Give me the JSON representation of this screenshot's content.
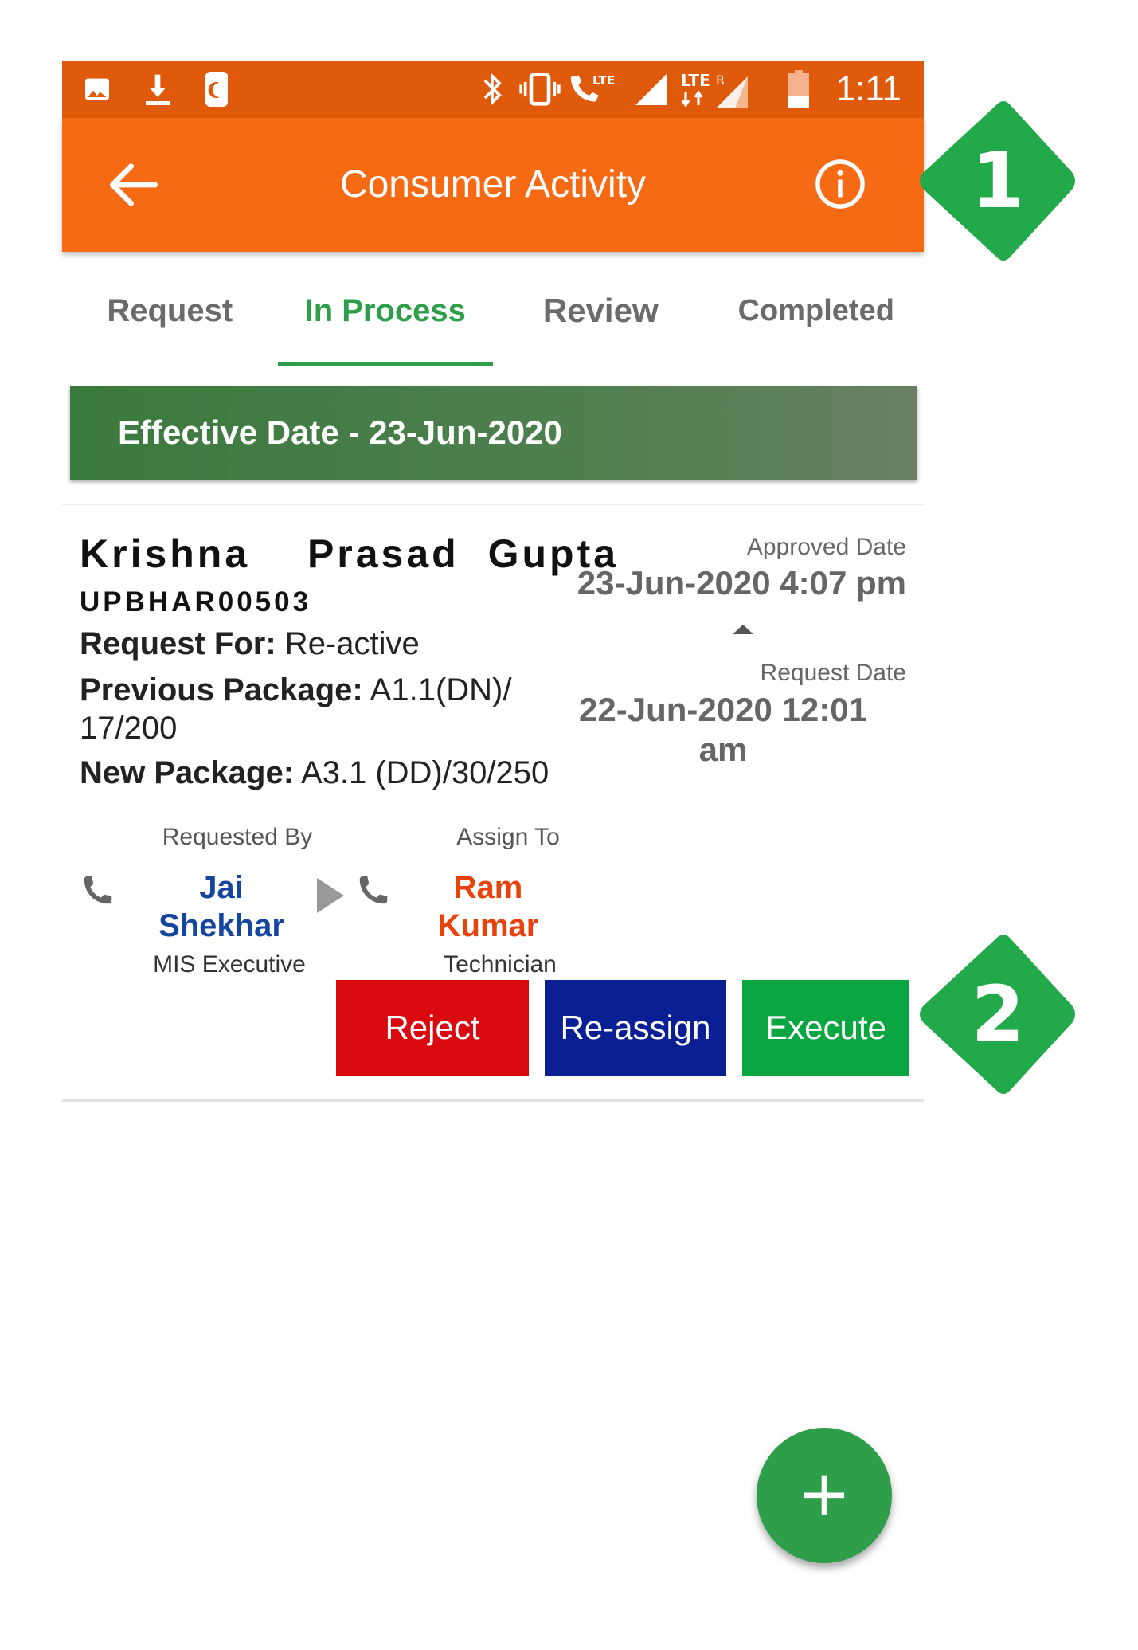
{
  "status_bar": {
    "time": "1:11",
    "left_icons": [
      "image-icon",
      "download-icon",
      "moon-notification-icon"
    ],
    "right_icons": [
      "bluetooth-icon",
      "vibrate-icon",
      "volte-call-icon",
      "signal-icon",
      "lte-roaming-signal-icon",
      "battery-low-icon"
    ],
    "lte_label": "LTE",
    "roaming_label": "R"
  },
  "app_bar": {
    "title": "Consumer Activity",
    "back_icon": "arrow-left-icon",
    "info_icon": "info-icon"
  },
  "tabs": [
    {
      "label": "Request",
      "active": false
    },
    {
      "label": "In Process",
      "active": true
    },
    {
      "label": "Review",
      "active": false
    },
    {
      "label": "Completed",
      "active": false
    }
  ],
  "banner": {
    "text": "Effective Date - 23-Jun-2020"
  },
  "card": {
    "name": "Krishna  Prasad Gupta",
    "consumer_id": "UPBHAR00503",
    "request_for_label": "Request For:",
    "request_for_value": " Re-active",
    "previous_package_label": "Previous Package:",
    "previous_package_value": " A1.1(DN)/ 17/200",
    "new_package_label": "New Package:",
    "new_package_value": " A3.1 (DD)/30/250",
    "approved_date_label": "Approved Date",
    "approved_date_value": "23-Jun-2020 4:07 pm",
    "request_date_label": "Request Date",
    "request_date_value": "22-Jun-2020 12:01 am",
    "requested_by": {
      "label": "Requested By",
      "name": "Jai Shekhar",
      "role": "MIS Executive"
    },
    "assign_to": {
      "label": "Assign To",
      "name": "Ram Kumar",
      "role": "Technician"
    },
    "actions": {
      "reject": "Reject",
      "reassign": "Re-assign",
      "execute": "Execute"
    }
  },
  "fab": {
    "label": "+"
  },
  "callouts": [
    "1",
    "2"
  ],
  "colors": {
    "status_bar": "#e05a0c",
    "app_bar": "#f76a14",
    "accent_green": "#2e9e4a",
    "reject": "#d9090f",
    "reassign": "#0a1f94",
    "execute": "#0aa642",
    "requested_by_name": "#1446a0",
    "assign_to_name": "#e8410a",
    "callout": "#22a94a"
  }
}
